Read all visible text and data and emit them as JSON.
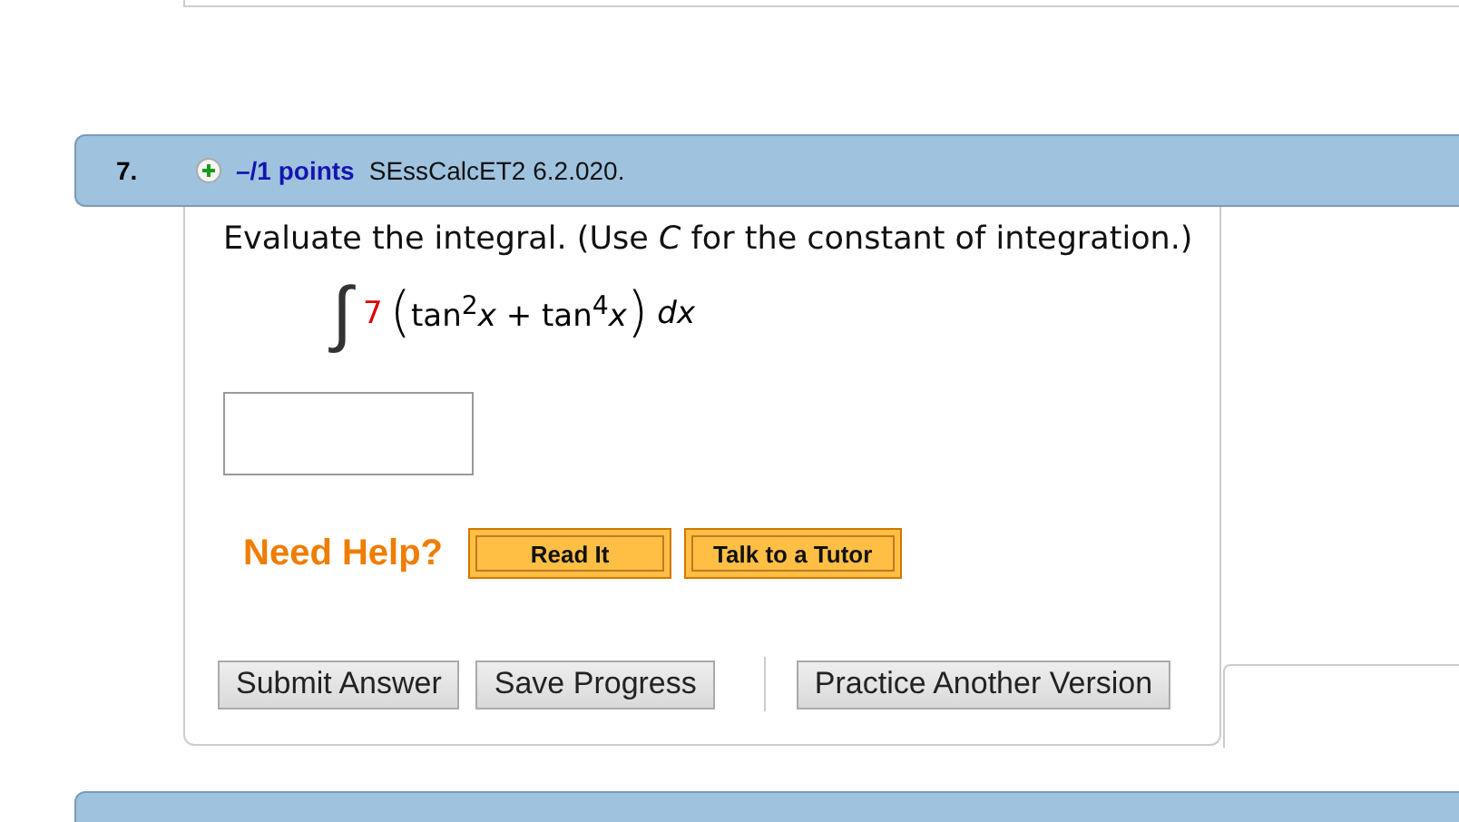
{
  "question": {
    "number": "7.",
    "points": "–/1 points",
    "reference": "SEssCalcET2 6.2.020.",
    "prompt": "Evaluate the integral. (Use *C* for the constant of integration.)",
    "integral": {
      "sign": "∫",
      "coefficient": "7",
      "open_paren": "(",
      "integrand": "tan$^{2}$*x* + tan$^{4}$*x*",
      "close_paren": ")",
      "differential": "dx"
    },
    "help": {
      "label": "Need Help?",
      "buttons": [
        "Read It",
        "Talk to a Tutor"
      ]
    },
    "actions": [
      "Submit Answer",
      "Save Progress"
    ],
    "practice": "Practice Another Version"
  }
}
